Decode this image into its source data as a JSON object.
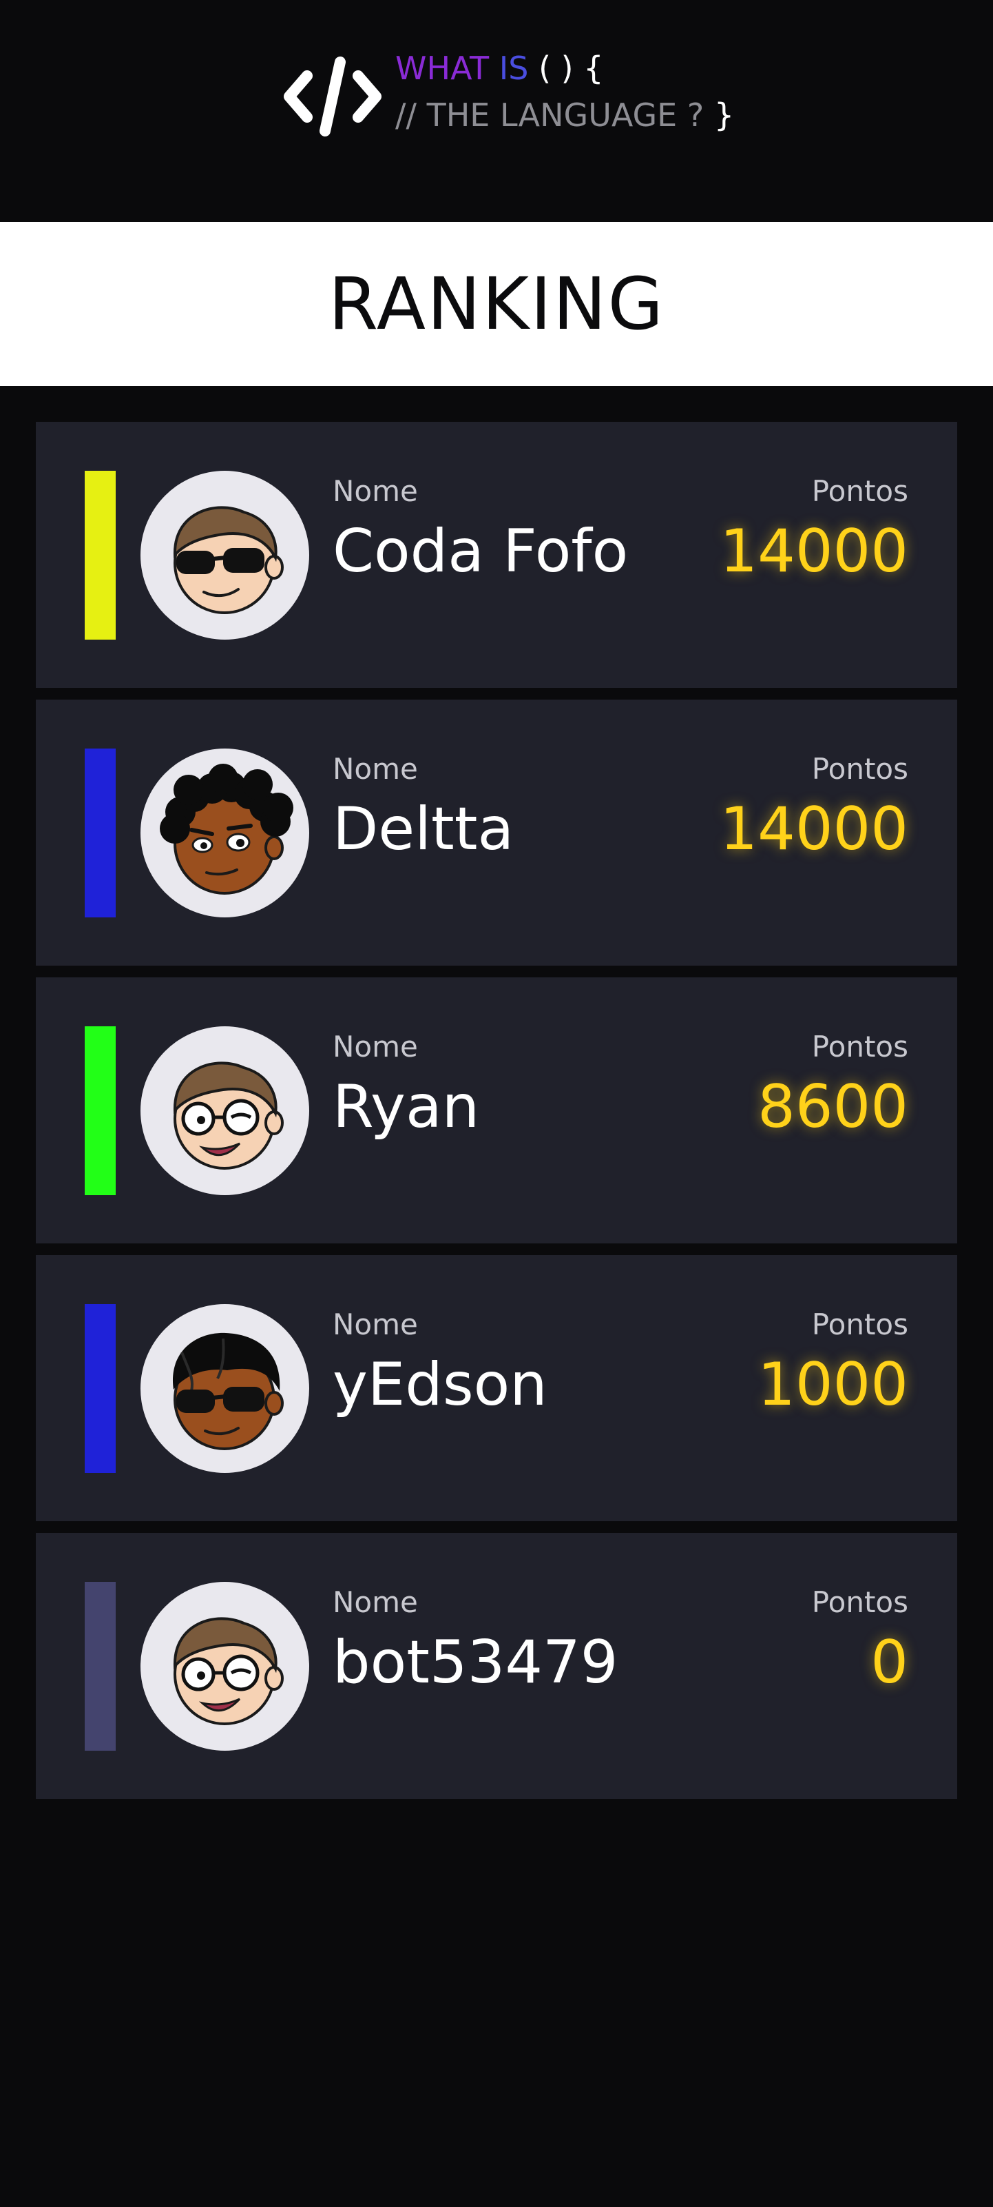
{
  "logo": {
    "icon": "code-brackets-icon",
    "what": "WHAT",
    "is": "IS",
    "braces": "( ) {",
    "comment": "// THE LANGUAGE ?",
    "close_brace": "}",
    "colors": {
      "what": "#8a2bd6",
      "is": "#4a4ee0"
    }
  },
  "header": {
    "title": "RANKING"
  },
  "ranking": [
    {
      "name_label": "Nome",
      "name": "Coda Fofo",
      "points_label": "Pontos",
      "points": "14000",
      "color": "#e6f012",
      "avatar": "avatar-sunglasses-light"
    },
    {
      "name_label": "Nome",
      "name": "Deltta",
      "points_label": "Pontos",
      "points": "14000",
      "color": "#1f22d8",
      "avatar": "avatar-curly-dark"
    },
    {
      "name_label": "Nome",
      "name": "Ryan",
      "points_label": "Pontos",
      "points": "8600",
      "color": "#22ff17",
      "avatar": "avatar-glasses-light"
    },
    {
      "name_label": "Nome",
      "name": "yEdson",
      "points_label": "Pontos",
      "points": "1000",
      "color": "#1f22d8",
      "avatar": "avatar-sunglasses-dark"
    },
    {
      "name_label": "Nome",
      "name": "bot53479",
      "points_label": "Pontos",
      "points": "0",
      "color": "#44446e",
      "avatar": "avatar-glasses-light"
    }
  ]
}
